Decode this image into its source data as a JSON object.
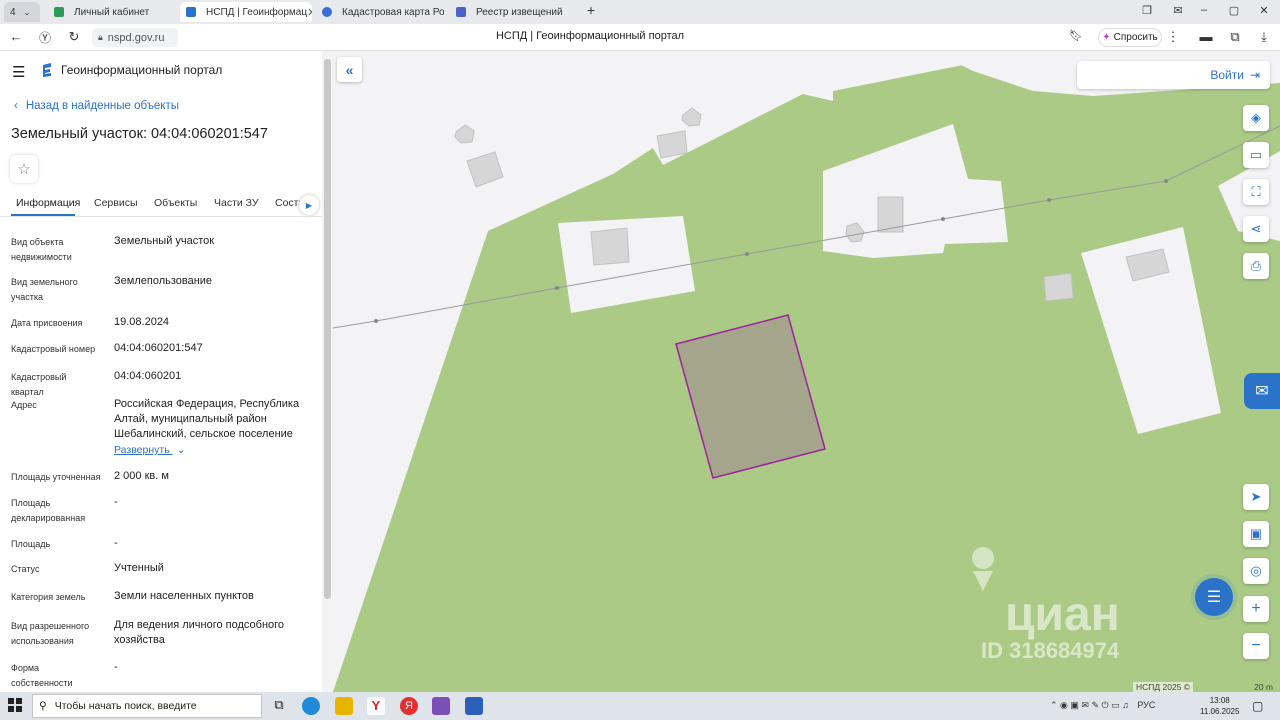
{
  "browser": {
    "tab_counter": "4",
    "tabs": [
      {
        "label": "Личный кабинет",
        "active": false
      },
      {
        "label": "НСПД | Геоинформац",
        "active": true
      },
      {
        "label": "Кадастровая карта Росси",
        "active": false
      },
      {
        "label": "Реестр извещений",
        "active": false
      }
    ],
    "url": "nspd.gov.ru",
    "page_title": "НСПД | Геоинформационный портал",
    "ask_button": "Спросить"
  },
  "panel": {
    "portal_title": "Геоинформационный портал",
    "back_link": "Назад в найденные объекты",
    "parcel_title": "Земельный участок: 04:04:060201:547",
    "tabs": [
      "Информация",
      "Сервисы",
      "Объекты",
      "Части ЗУ",
      "Соста"
    ],
    "fields": [
      {
        "label": "Вид объекта недвижимости",
        "value": "Земельный участок"
      },
      {
        "label": "Вид земельного участка",
        "value": "Землепользование"
      },
      {
        "label": "Дата присвоения",
        "value": "19.08.2024"
      },
      {
        "label": "Кадастровый номер",
        "value": "04:04:060201:547"
      },
      {
        "label": "Кадастровый квартал",
        "value": "04:04:060201"
      },
      {
        "label": "Адрес",
        "value": "Российская Федерация, Республика Алтай, муниципальный район Шебалинский, сельское поселение"
      },
      {
        "label": "Площадь уточненная",
        "value": "2 000 кв. м"
      },
      {
        "label": "Площадь декларированная",
        "value": "-"
      },
      {
        "label": "Площадь",
        "value": "-"
      },
      {
        "label": "Статус",
        "value": "Учтенный"
      },
      {
        "label": "Категория земель",
        "value": "Земли населенных пунктов"
      },
      {
        "label": "Вид разрешенного использования",
        "value": "Для ведения личного подсобного хозяйства"
      },
      {
        "label": "Форма собственности",
        "value": "-"
      }
    ],
    "expand_link": "Развернуть"
  },
  "map": {
    "login_label": "Войти",
    "copyright": "НСПД 2025 ©",
    "scale_label": "20 m",
    "watermark_brand": "циан",
    "watermark_id": "ID 318684974",
    "colors": {
      "green": "#abca86",
      "light": "#f3f3f5",
      "building": "#d4d4d4",
      "parcel_fill": "#a4a58a",
      "parcel_stroke": "#a020a0",
      "accent": "#2a73c8"
    }
  },
  "taskbar": {
    "search_placeholder": "Чтобы начать поиск, введите",
    "lang": "РУС",
    "time": "13:08",
    "date": "11.06.2025"
  }
}
